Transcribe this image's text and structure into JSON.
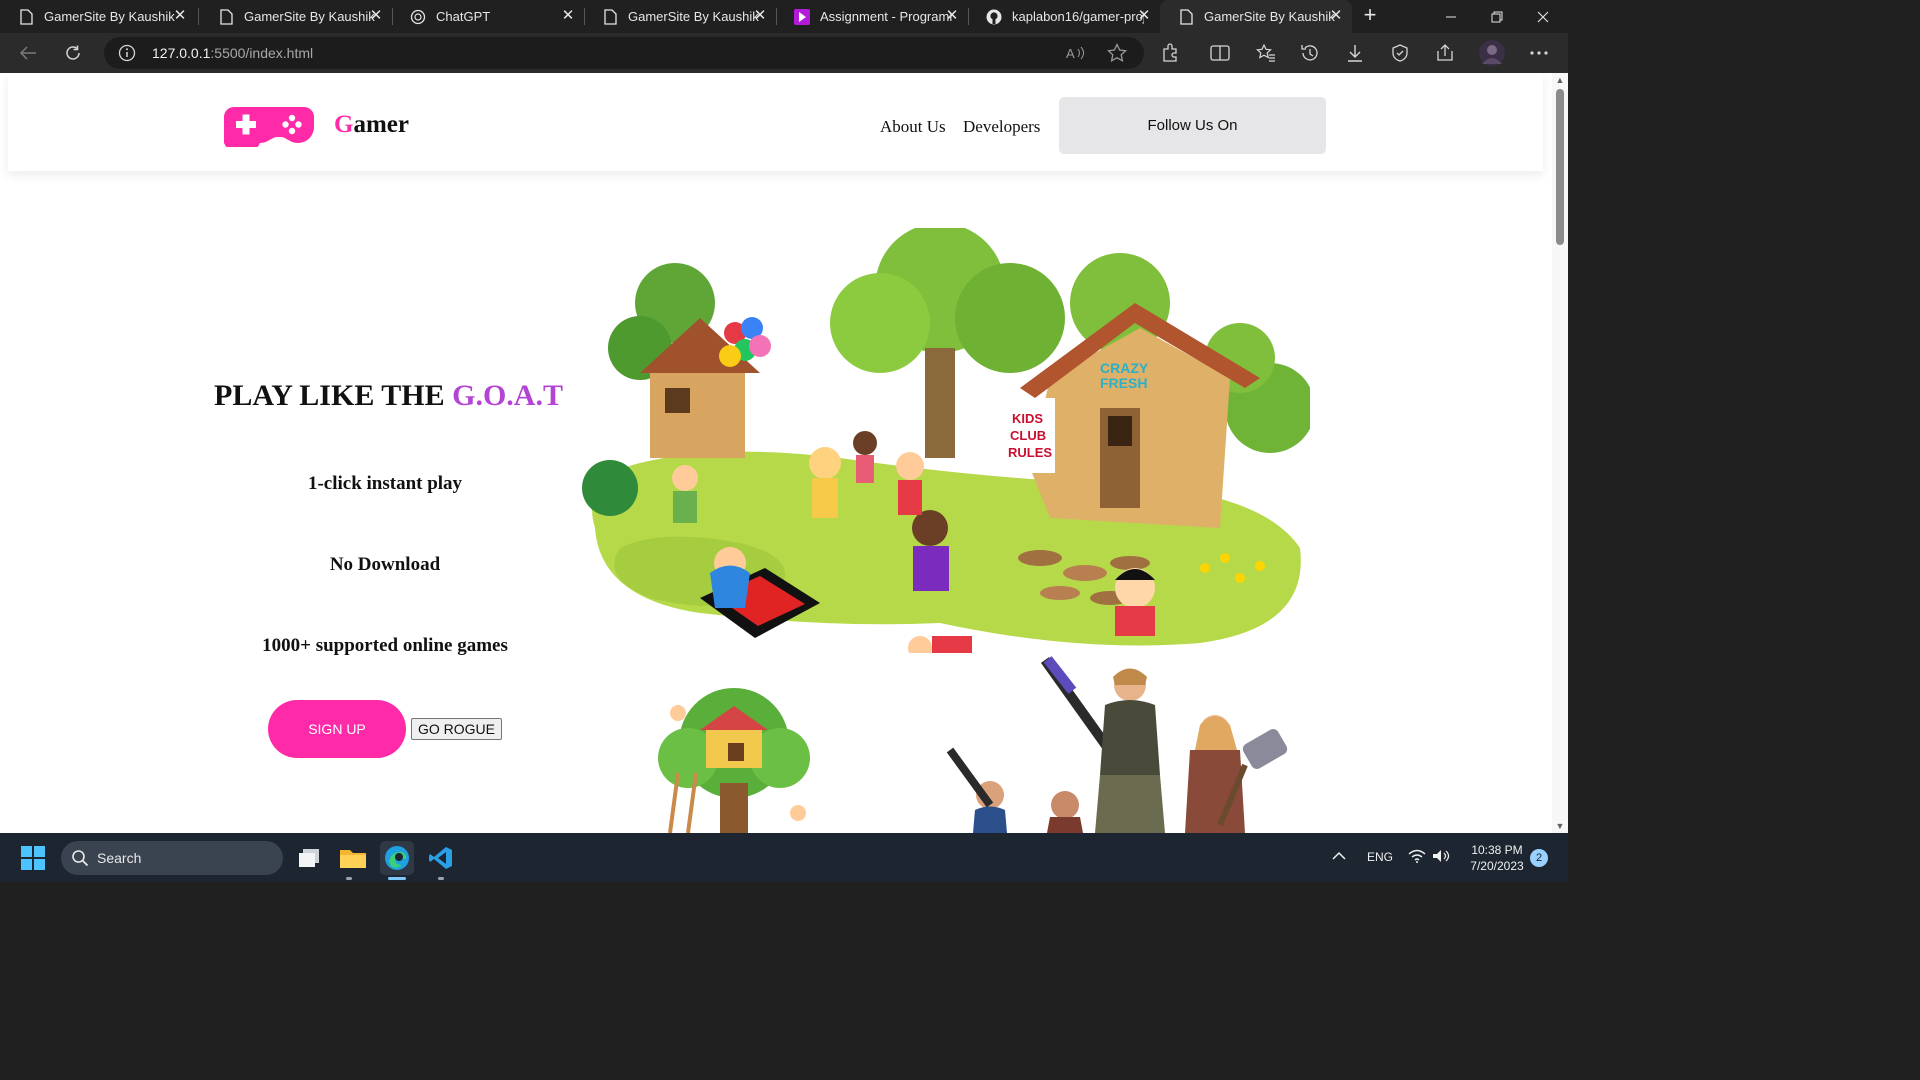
{
  "browser": {
    "tabs": [
      {
        "title": "GamerSite By Kaushik",
        "icon": "page-icon"
      },
      {
        "title": "GamerSite By Kaushik",
        "icon": "page-icon"
      },
      {
        "title": "ChatGPT",
        "icon": "chatgpt-icon"
      },
      {
        "title": "GamerSite By Kaushik",
        "icon": "page-icon"
      },
      {
        "title": "Assignment - Programmi",
        "icon": "programming-hero-icon"
      },
      {
        "title": "kaplabon16/gamer-proj",
        "icon": "github-icon"
      },
      {
        "title": "GamerSite By Kaushik",
        "icon": "page-icon",
        "active": true
      }
    ],
    "close_glyph": "✕",
    "new_tab_glyph": "+",
    "address": {
      "host": "127.0.0.1",
      "rest": ":5500/index.html"
    }
  },
  "site": {
    "brand_first": "G",
    "brand_rest": "amer",
    "nav": {
      "about": "About Us",
      "developers": "Developers",
      "follow": "Follow Us On"
    },
    "hero": {
      "title_main": "PLAY LIKE THE ",
      "title_accent": "G.O.A.T",
      "features": [
        "1-click instant play",
        "No Download",
        "1000+ supported online games"
      ],
      "signup": "SIGN UP",
      "rogue": "GO ROGUE"
    },
    "colors": {
      "accent_pink": "#ff2aa8",
      "accent_purple": "#b444d4"
    }
  },
  "taskbar": {
    "search_label": "Search",
    "language": "ENG",
    "time": "10:38 PM",
    "date": "7/20/2023",
    "notifications": "2"
  }
}
